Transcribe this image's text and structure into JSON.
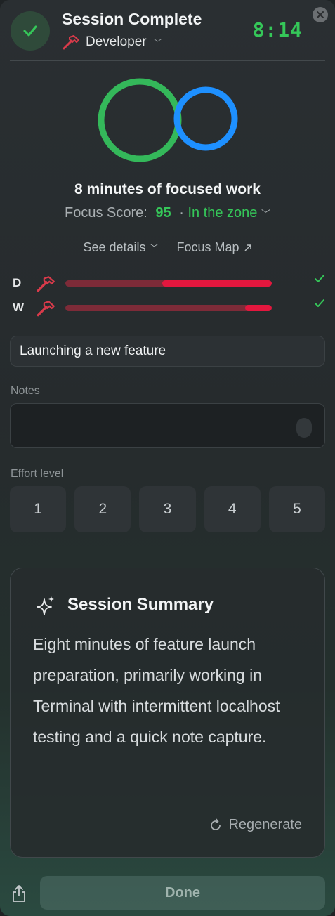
{
  "header": {
    "title": "Session Complete",
    "role": "Developer",
    "timer": "8:14"
  },
  "focus": {
    "headline": "8 minutes of focused work",
    "score_label": "Focus Score:",
    "score_value": "95",
    "separator": "·",
    "zone_label": "In the zone",
    "see_details": "See details",
    "focus_map": "Focus Map"
  },
  "rings": {
    "focus_ring_color": "#35c759",
    "secondary_ring_color": "#1e90ff"
  },
  "progress": [
    {
      "label": "D",
      "value_percent": 53,
      "done": true
    },
    {
      "label": "W",
      "value_percent": 13,
      "done": true
    }
  ],
  "colors": {
    "accent_green": "#35c759",
    "bar_fill": "#e3173e",
    "bar_track": "#7d2b38",
    "role_icon": "#d83a4a"
  },
  "intent": {
    "value": "Launching a new feature"
  },
  "notes": {
    "label": "Notes",
    "value": ""
  },
  "effort": {
    "label": "Effort level",
    "options": [
      "1",
      "2",
      "3",
      "4",
      "5"
    ]
  },
  "summary": {
    "title": "Session Summary",
    "text": "Eight minutes of feature launch preparation, primarily working in Terminal with intermittent localhost testing and a quick note capture.",
    "regenerate": "Regenerate"
  },
  "footer": {
    "done": "Done"
  },
  "icons": [
    "checkmark-icon",
    "hammer-icon",
    "chevron-down-icon",
    "close-icon",
    "arrow-up-right-icon",
    "sparkles-icon",
    "refresh-icon",
    "share-icon",
    "microphone-icon"
  ]
}
